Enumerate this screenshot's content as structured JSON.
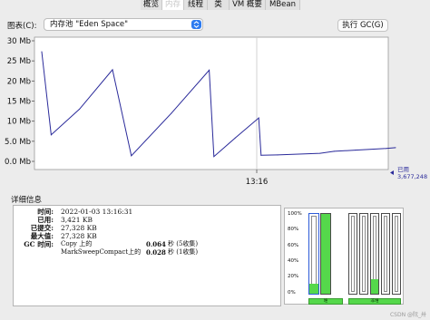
{
  "tabs": [
    {
      "label": "概览",
      "active": false
    },
    {
      "label": "内存",
      "active": true
    },
    {
      "label": "线程",
      "active": false
    },
    {
      "label": "类",
      "active": false
    },
    {
      "label": "VM 概要",
      "active": false
    },
    {
      "label": "MBean",
      "active": false
    }
  ],
  "chart_selector": {
    "label": "图表(C):",
    "value": "内存池 \"Eden Space\""
  },
  "gc_button": {
    "label": "执行 GC(G)"
  },
  "chart_data": {
    "type": "line",
    "y_tick_labels": [
      "30 Mb",
      "25 Mb",
      "20 Mb",
      "15 Mb",
      "10 Mb",
      "5.0 Mb",
      "0.0 Mb"
    ],
    "x_tick_labels": [
      "13:16"
    ],
    "ylim": [
      0,
      30
    ],
    "y_unit": "Mb",
    "series": [
      {
        "name": "已用",
        "color": "#2a2a9a",
        "x": [
          0,
          4,
          16,
          30,
          38,
          55,
          71,
          73,
          82,
          92,
          93,
          100,
          118,
          124,
          133,
          146,
          150
        ],
        "values": [
          27.3,
          6.6,
          13.0,
          22.8,
          1.4,
          12.0,
          22.7,
          1.2,
          5.8,
          10.8,
          1.5,
          1.6,
          2.0,
          2.5,
          2.8,
          3.2,
          3.4
        ]
      }
    ],
    "legend": {
      "series_name": "已用",
      "value_label": "3,677,248"
    }
  },
  "details": {
    "title": "详细信息",
    "rows": [
      {
        "key": "时间:",
        "value": "2022-01-03 13:16:31"
      },
      {
        "key": "已用:",
        "value": "3,421 KB"
      },
      {
        "key": "已提交:",
        "value": "27,328 KB"
      },
      {
        "key": "最大值:",
        "value": "27,328 KB"
      }
    ],
    "gc_key": "GC 时间:",
    "gc_lines": [
      {
        "collector": "Copy 上的",
        "time": "0.064",
        "unit": "秒 (5收集)"
      },
      {
        "collector": "MarkSweepCompact上的",
        "time": "0.028",
        "unit": "秒 (1收集)"
      }
    ]
  },
  "pool_chart": {
    "ticks": [
      "100%",
      "80%",
      "60%",
      "40%",
      "20%",
      "0%"
    ],
    "heap_label": "堆",
    "nonheap_label": "非堆",
    "pools": [
      {
        "group": "heap",
        "fill_percent": 13,
        "selected": true
      },
      {
        "group": "heap",
        "fill_percent": 100,
        "selected": false
      },
      {
        "group": "nonheap",
        "fill_percent": 0,
        "selected": false
      },
      {
        "group": "nonheap",
        "fill_percent": 0,
        "selected": false
      },
      {
        "group": "nonheap",
        "fill_percent": 18,
        "selected": false
      },
      {
        "group": "nonheap",
        "fill_percent": 0,
        "selected": false
      },
      {
        "group": "nonheap",
        "fill_percent": 0,
        "selected": false
      }
    ]
  },
  "watermark": "CSDN @阮_卅"
}
